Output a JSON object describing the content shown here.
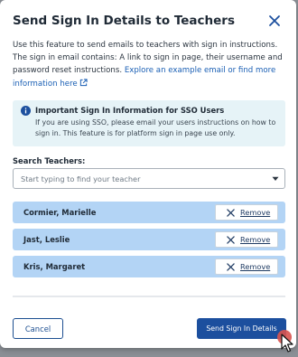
{
  "dialog": {
    "title": "Send Sign In Details to Teachers",
    "close_icon": "close-icon"
  },
  "intro": {
    "text": "Use this feature to send emails to teachers with sign in instructions. The sign in email contains: A link to sign in page, their username and password reset instructions. ",
    "link_text": "Explore an example email or find more information here",
    "link_icon": "external-link-icon"
  },
  "info": {
    "icon": "info-icon",
    "title": "Important Sign In Information for SSO Users",
    "body": "If you are using SSO, please email your users instructions on how to sign in. This feature is for platform sign in page use only."
  },
  "search": {
    "label": "Search Teachers:",
    "placeholder": "Start typing to find your teacher",
    "value": ""
  },
  "teachers": [
    {
      "name": "Cormier, Marielle",
      "remove_label": "Remove"
    },
    {
      "name": "Jast, Leslie",
      "remove_label": "Remove"
    },
    {
      "name": "Kris, Margaret",
      "remove_label": "Remove"
    }
  ],
  "footer": {
    "cancel_label": "Cancel",
    "send_label": "Send Sign In Details"
  },
  "colors": {
    "primary": "#1c4f9e",
    "row_bg": "#b3d4f5",
    "info_bg": "#e6f3f7",
    "link": "#1a5fb4"
  }
}
